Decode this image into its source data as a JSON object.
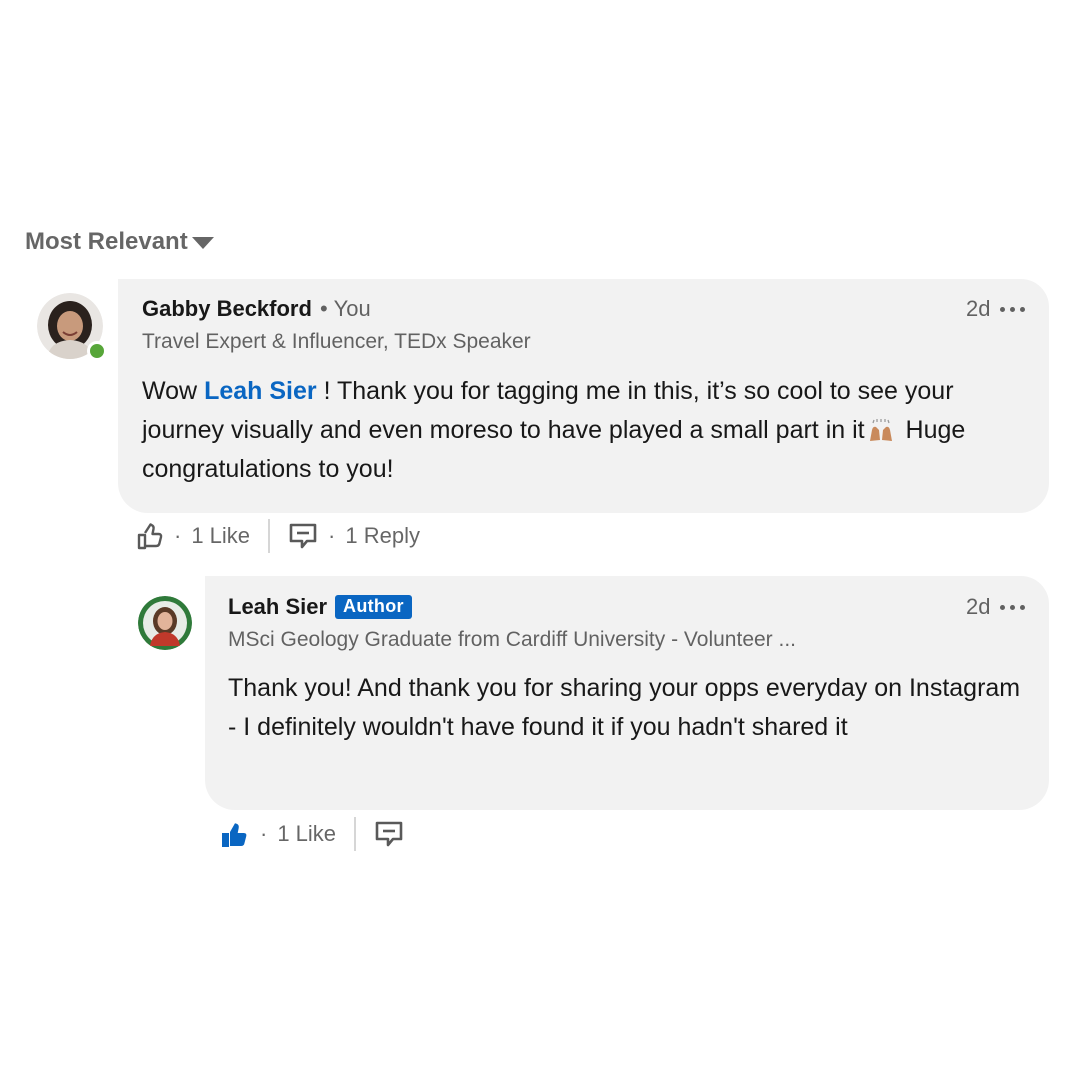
{
  "sort": {
    "label": "Most Relevant",
    "caret_icon": "caret-down-icon"
  },
  "comments": [
    {
      "author_name": "Gabby Beckford",
      "relation": "You",
      "headline": "Travel Expert & Influencer, TEDx Speaker",
      "time": "2d",
      "online": true,
      "text_before": "Wow ",
      "mention": "Leah Sier",
      "text_after_mention": " ! Thank you for tagging me in this, it’s so cool to see your journey visually and even moreso to have played a small part in it",
      "emoji": "raising-hands-emoji",
      "text_end": " Huge congratulations to you!",
      "like_count_label": "1 Like",
      "reply_count_label": "1 Reply",
      "liked": false
    },
    {
      "author_name": "Leah Sier",
      "badge": "Author",
      "headline": "MSci Geology Graduate from Cardiff University - Volunteer ...",
      "time": "2d",
      "text": "Thank you! And thank you for sharing your opps everyday on Instagram - I definitely wouldn't have found it if you hadn't shared it",
      "like_count_label": "1 Like",
      "liked": true
    }
  ],
  "colors": {
    "bubble_bg": "#f2f2f2",
    "link_blue": "#0a66c2",
    "online_green": "#57a639",
    "muted_text": "rgba(0,0,0,0.6)"
  }
}
